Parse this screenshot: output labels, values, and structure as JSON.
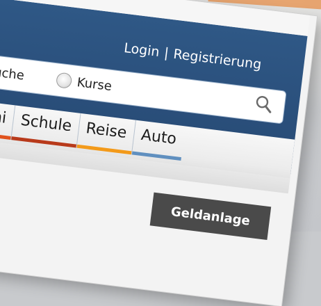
{
  "header": {
    "login_label": "Login",
    "separator": "|",
    "register_label": "Registrierung"
  },
  "search": {
    "options": [
      {
        "label": "Suche",
        "selected": true
      },
      {
        "label": "Kurse",
        "selected": false
      }
    ],
    "icon": "search-icon"
  },
  "tabs": [
    {
      "label": "Uni",
      "color": "#e0521d"
    },
    {
      "label": "Schule",
      "color": "#b83a1b"
    },
    {
      "label": "Reise",
      "color": "#f39a1a"
    },
    {
      "label": "Auto",
      "color": "#5f8fbf"
    }
  ],
  "button": {
    "label": "Geldanlage"
  },
  "colors": {
    "header_blue": "#2a4f7b",
    "button_dark": "#4a4a4a"
  }
}
